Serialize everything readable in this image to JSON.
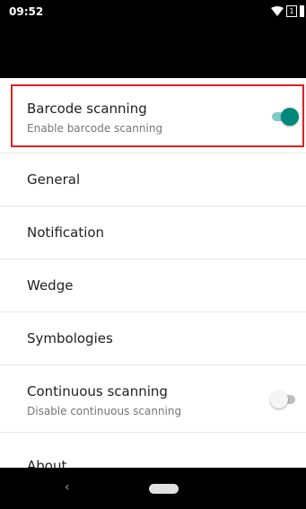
{
  "status_bar": {
    "time": "09:52",
    "sim_label": "1",
    "icons": [
      "wifi-icon",
      "sim-icon",
      "battery-icon"
    ]
  },
  "settings": {
    "barcode_scanning": {
      "title": "Barcode scanning",
      "subtitle": "Enable barcode scanning",
      "enabled": true
    },
    "general": {
      "title": "General"
    },
    "notification": {
      "title": "Notification"
    },
    "wedge": {
      "title": "Wedge"
    },
    "symbologies": {
      "title": "Symbologies"
    },
    "continuous_scanning": {
      "title": "Continuous scanning",
      "subtitle": "Disable continuous scanning",
      "enabled": false
    },
    "about": {
      "title": "About"
    }
  },
  "nav_bar": {
    "icons": [
      "back-icon",
      "home-pill"
    ]
  },
  "colors": {
    "accent": "#00897b",
    "accent_track": "#80cbc4",
    "highlight": "#e02020"
  }
}
